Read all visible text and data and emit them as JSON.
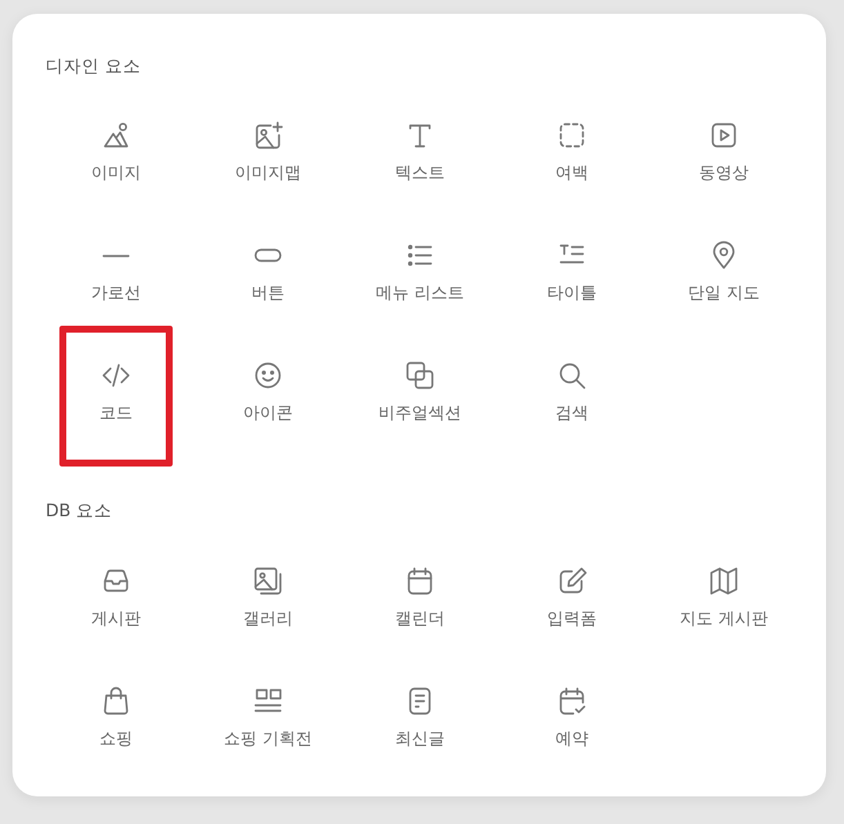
{
  "sections": [
    {
      "title": "디자인 요소",
      "items": [
        {
          "label": "이미지",
          "highlighted": false
        },
        {
          "label": "이미지맵",
          "highlighted": false
        },
        {
          "label": "텍스트",
          "highlighted": false
        },
        {
          "label": "여백",
          "highlighted": false
        },
        {
          "label": "동영상",
          "highlighted": false
        },
        {
          "label": "가로선",
          "highlighted": false
        },
        {
          "label": "버튼",
          "highlighted": false
        },
        {
          "label": "메뉴 리스트",
          "highlighted": false
        },
        {
          "label": "타이틀",
          "highlighted": false
        },
        {
          "label": "단일 지도",
          "highlighted": false
        },
        {
          "label": "코드",
          "highlighted": true
        },
        {
          "label": "아이콘",
          "highlighted": false
        },
        {
          "label": "비주얼섹션",
          "highlighted": false
        },
        {
          "label": "검색",
          "highlighted": false
        }
      ]
    },
    {
      "title": "DB 요소",
      "items": [
        {
          "label": "게시판",
          "highlighted": false
        },
        {
          "label": "갤러리",
          "highlighted": false
        },
        {
          "label": "캘린더",
          "highlighted": false
        },
        {
          "label": "입력폼",
          "highlighted": false
        },
        {
          "label": "지도 게시판",
          "highlighted": false
        },
        {
          "label": "쇼핑",
          "highlighted": false
        },
        {
          "label": "쇼핑 기획전",
          "highlighted": false
        },
        {
          "label": "최신글",
          "highlighted": false
        },
        {
          "label": "예약",
          "highlighted": false
        }
      ]
    }
  ]
}
